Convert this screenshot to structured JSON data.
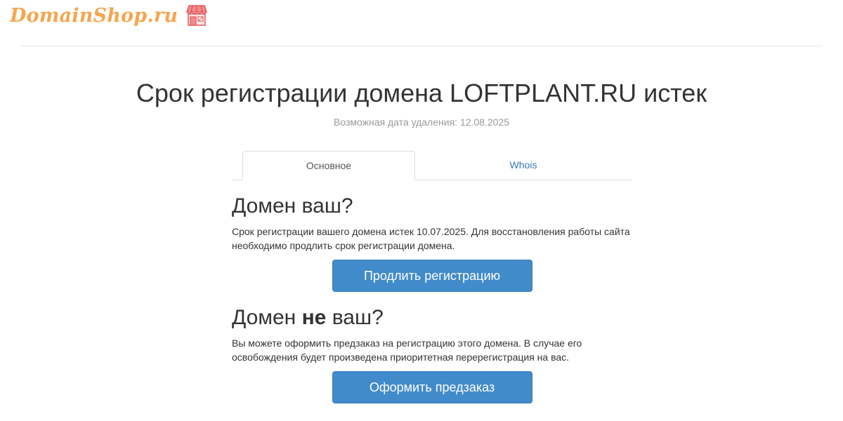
{
  "header": {
    "logo_text": "DomainShop.ru",
    "logo_icon": "storefront-icon",
    "accent_color": "#f5a64f"
  },
  "page": {
    "title": "Срок регистрации домена LOFTPLANT.RU истек",
    "subtitle": "Возможная дата удаления: 12.08.2025"
  },
  "tabs": [
    {
      "label": "Основное",
      "active": true
    },
    {
      "label": "Whois",
      "active": false
    }
  ],
  "section_owner": {
    "heading": "Домен ваш?",
    "text": "Срок регистрации вашего домена истек 10.07.2025. Для восстановления работы сайта необходимо продлить срок регистрации домена.",
    "button_label": "Продлить регистрацию"
  },
  "section_not_owner": {
    "heading_start": "Домен ",
    "heading_bold": "не",
    "heading_end": " ваш?",
    "text": "Вы можете оформить предзаказ на регистрацию этого домена. В случае его освобождения будет произведена приоритетная перерегистрация на вас.",
    "button_label": "Оформить предзаказ"
  },
  "colors": {
    "button_bg": "#428bca",
    "link": "#337ab7"
  }
}
